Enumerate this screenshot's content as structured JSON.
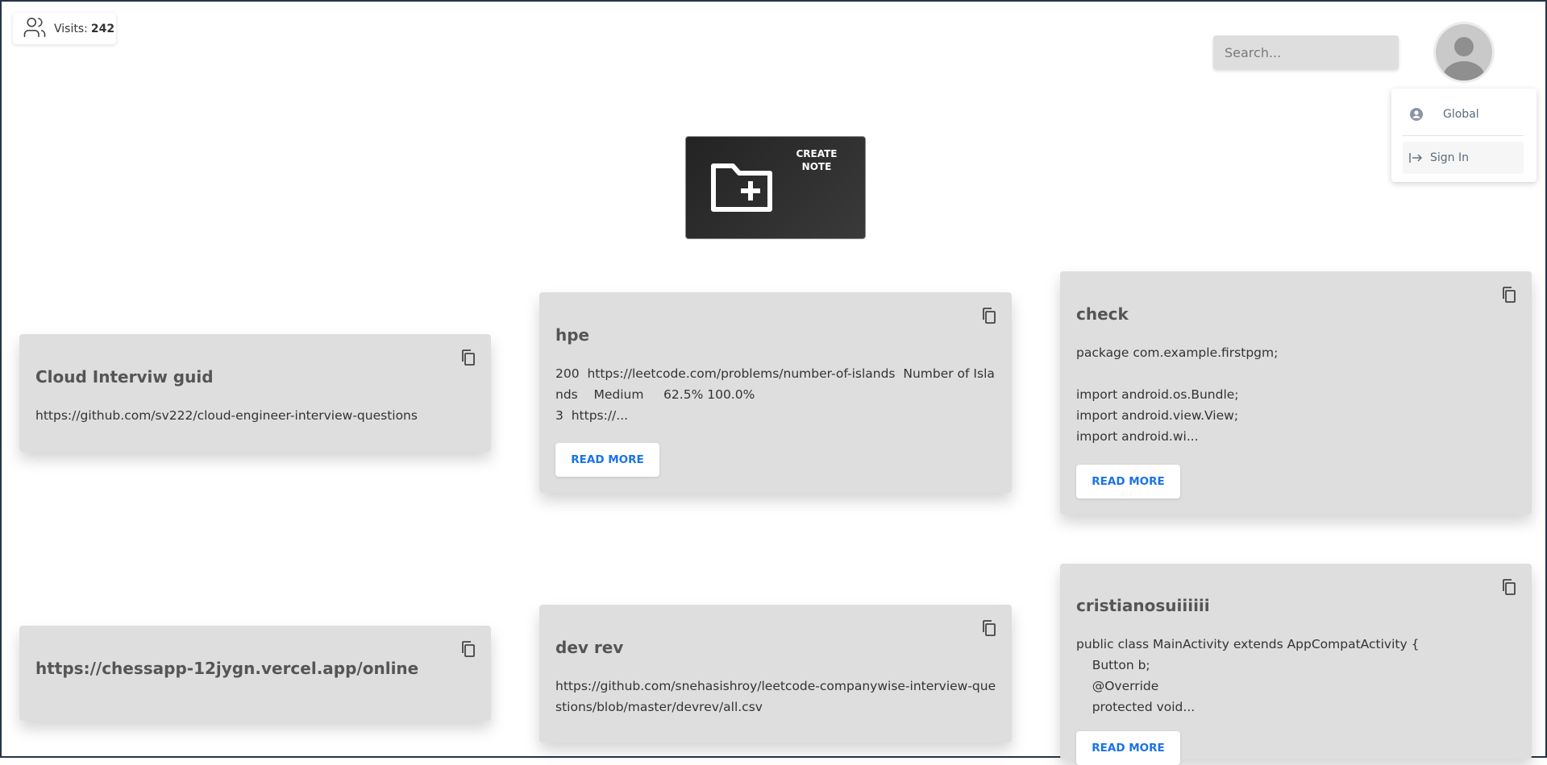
{
  "visits": {
    "label": "Visits:",
    "count": "242",
    "icon": "users-icon"
  },
  "search": {
    "placeholder": "Search...",
    "value": ""
  },
  "user_menu": {
    "items": [
      {
        "label": "Global",
        "icon": "account-circle-icon"
      },
      {
        "label": "Sign In",
        "icon": "sign-in-icon"
      }
    ]
  },
  "create_note": {
    "label": "CREATE NOTE",
    "icon": "folder-plus-icon"
  },
  "cards": [
    {
      "title": "Cloud Interviw guid",
      "body": "https://github.com/sv222/cloud-engineer-interview-questions",
      "has_read_more": false
    },
    {
      "title": "hpe",
      "body": "200  https://leetcode.com/problems/number-of-islands  Number of Islands    Medium     62.5% 100.0%\n3  https://...",
      "has_read_more": true
    },
    {
      "title": "check",
      "body": "package com.example.firstpgm;\n\nimport android.os.Bundle;\nimport android.view.View;\nimport android.wi...",
      "has_read_more": true
    },
    {
      "title": "https://chessapp-12jygn.vercel.app/online",
      "body": "",
      "has_read_more": false
    },
    {
      "title": "dev rev",
      "body": "https://github.com/snehasishroy/leetcode-companywise-interview-questions/blob/master/devrev/all.csv",
      "has_read_more": false
    },
    {
      "title": "cristianosuiiiiii",
      "body": "public class MainActivity extends AppCompatActivity {\n    Button b;\n    @Override\n    protected void...",
      "has_read_more": true
    }
  ],
  "read_more_label": "READ MORE",
  "colors": {
    "accent": "#1a73e8",
    "card_bg": "#dedede",
    "create_bg": "#2a2a2a"
  }
}
